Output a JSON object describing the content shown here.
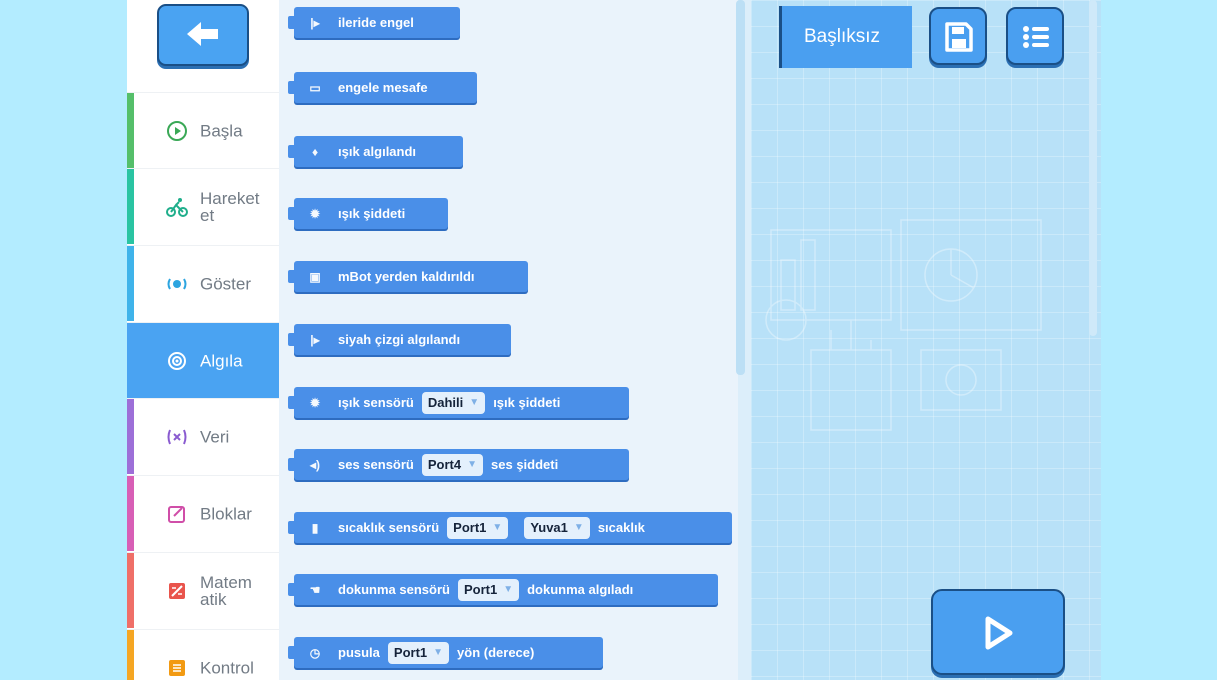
{
  "sidebar": {
    "categories": [
      {
        "label": "Başla",
        "color": "#55bf6a",
        "icon": "play-circle-icon"
      },
      {
        "label": "Hareket et",
        "color": "#2ac4a2",
        "icon": "bike-icon"
      },
      {
        "label": "Göster",
        "color": "#3fb3ea",
        "icon": "light-display-icon"
      },
      {
        "label": "Algıla",
        "color": "#4aa3f2",
        "icon": "sensor-icon",
        "active": true
      },
      {
        "label": "Veri",
        "color": "#9d6fd8",
        "icon": "variable-icon"
      },
      {
        "label": "Bloklar",
        "color": "#d85fb6",
        "icon": "edit-block-icon"
      },
      {
        "label": "Matem atik",
        "color": "#ef6f68",
        "icon": "math-icon"
      },
      {
        "label": "Kontrol",
        "color": "#f5a623",
        "icon": "control-icon"
      }
    ]
  },
  "blocks": {
    "b1": {
      "text": "ileride engel"
    },
    "b2": {
      "text": "engele mesafe"
    },
    "b3": {
      "text": "ışık algılandı"
    },
    "b4": {
      "text": "ışık şiddeti"
    },
    "b5": {
      "text": "mBot yerden kaldırıldı"
    },
    "b6": {
      "text": "siyah çizgi algılandı"
    },
    "b7": {
      "pre": "ışık sensörü",
      "dd": "Dahili",
      "post": "ışık şiddeti"
    },
    "b8": {
      "pre": "ses sensörü",
      "dd": "Port4",
      "post": "ses şiddeti"
    },
    "b9": {
      "pre": "sıcaklık sensörü",
      "dd1": "Port1",
      "dd2": "Yuva1",
      "post": "sıcaklık"
    },
    "b10": {
      "pre": "dokunma sensörü",
      "dd": "Port1",
      "post": "dokunma algıladı"
    },
    "b11": {
      "pre": "pusula",
      "dd": "Port1",
      "post": "yön (derece)"
    }
  },
  "project": {
    "title": "Başlıksız"
  },
  "toolbar": {
    "save_icon": "save-icon",
    "menu_icon": "list-menu-icon",
    "run_icon": "play-icon"
  },
  "colors": {
    "accent": "#4aa3f2",
    "block": "#4a8fe8",
    "outer_bg": "#b3ecff"
  }
}
